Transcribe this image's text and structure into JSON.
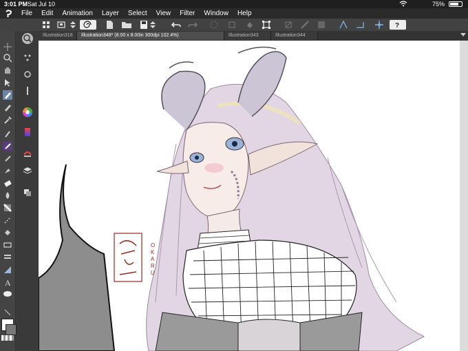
{
  "status_bar": {
    "time": "3:01 PM",
    "date": "Sat Jul 10",
    "battery": "75%",
    "battery_level": 0.75
  },
  "menu": {
    "items": [
      "File",
      "Edit",
      "Animation",
      "Layer",
      "Select",
      "View",
      "Filter",
      "Window",
      "Help"
    ]
  },
  "tabs": [
    {
      "label": "Illustration316",
      "active": false
    },
    {
      "label": "Illustration348* (8.00 x 8.00in 300dpi 102.4%)",
      "active": true
    },
    {
      "label": "Illustration343",
      "active": false
    },
    {
      "label": "Illustration344",
      "active": false
    }
  ],
  "toolbar": {
    "help_icon": "question-icon"
  },
  "canvas": {
    "signature_text": "OKARU",
    "colors": {
      "stamp": "#9b2a1a",
      "hair": "#d9cbd8",
      "horn": "#cfc7d6",
      "arm": "#8d8d8d"
    }
  }
}
